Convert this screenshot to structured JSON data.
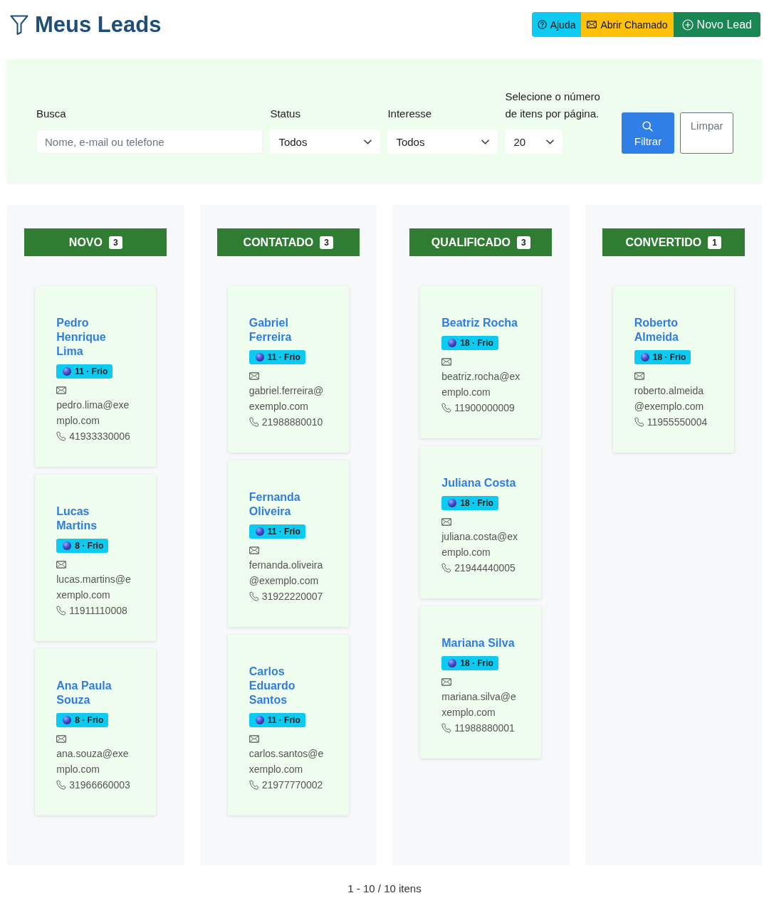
{
  "header": {
    "title": "Meus Leads",
    "buttons": [
      {
        "label": "Ajuda",
        "kind": "help"
      },
      {
        "label": "Abrir Chamado",
        "kind": "ticket"
      },
      {
        "label": "Novo Lead",
        "kind": "new"
      }
    ]
  },
  "filters": {
    "search": {
      "label": "Busca",
      "placeholder": "Nome, e-mail ou telefone"
    },
    "selects": [
      {
        "label": "Status",
        "value": "Todos",
        "kind": "wide"
      },
      {
        "label": "Interesse",
        "value": "Todos",
        "kind": "wide"
      },
      {
        "label": "Selecione o número de itens por página.",
        "value": "20",
        "kind": "narrow"
      }
    ],
    "buttons": [
      {
        "label": "Filtrar",
        "kind": "primary"
      },
      {
        "label": "Limpar",
        "kind": "secondary"
      }
    ]
  },
  "columns": [
    {
      "title": "NOVO",
      "count": "3",
      "cards": [
        {
          "name": "Pedro Henrique Lima",
          "badge": "11 · Frio",
          "email": "pedro.lima@exemplo.com",
          "phone": "41933330006"
        },
        {
          "name": "Lucas Martins",
          "badge": "8 · Frio",
          "email": "lucas.martins@exemplo.com",
          "phone": "11911110008"
        },
        {
          "name": "Ana Paula Souza",
          "badge": "8 · Frio",
          "email": "ana.souza@exemplo.com",
          "phone": "31966660003"
        }
      ]
    },
    {
      "title": "CONTATADO",
      "count": "3",
      "cards": [
        {
          "name": "Gabriel Ferreira",
          "badge": "11 · Frio",
          "email": "gabriel.ferreira@exemplo.com",
          "phone": "21988880010"
        },
        {
          "name": "Fernanda Oliveira",
          "badge": "11 · Frio",
          "email": "fernanda.oliveira@exemplo.com",
          "phone": "31922220007"
        },
        {
          "name": "Carlos Eduardo Santos",
          "badge": "11 · Frio",
          "email": "carlos.santos@exemplo.com",
          "phone": "21977770002"
        }
      ]
    },
    {
      "title": "QUALIFICADO",
      "count": "3",
      "cards": [
        {
          "name": "Beatriz Rocha",
          "badge": "18 · Frio",
          "email": "beatriz.rocha@exemplo.com",
          "phone": "11900000009"
        },
        {
          "name": "Juliana Costa",
          "badge": "18 · Frio",
          "email": "juliana.costa@exemplo.com",
          "phone": "21944440005"
        },
        {
          "name": "Mariana Silva",
          "badge": "18 · Frio",
          "email": "mariana.silva@exemplo.com",
          "phone": "11988880001"
        }
      ]
    },
    {
      "title": "CONVERTIDO",
      "count": "1",
      "cards": [
        {
          "name": "Roberto Almeida",
          "badge": "18 · Frio",
          "email": "roberto.almeida@exemplo.com",
          "phone": "11955550004"
        }
      ]
    }
  ],
  "pagination": "1 - 10 / 10 itens"
}
